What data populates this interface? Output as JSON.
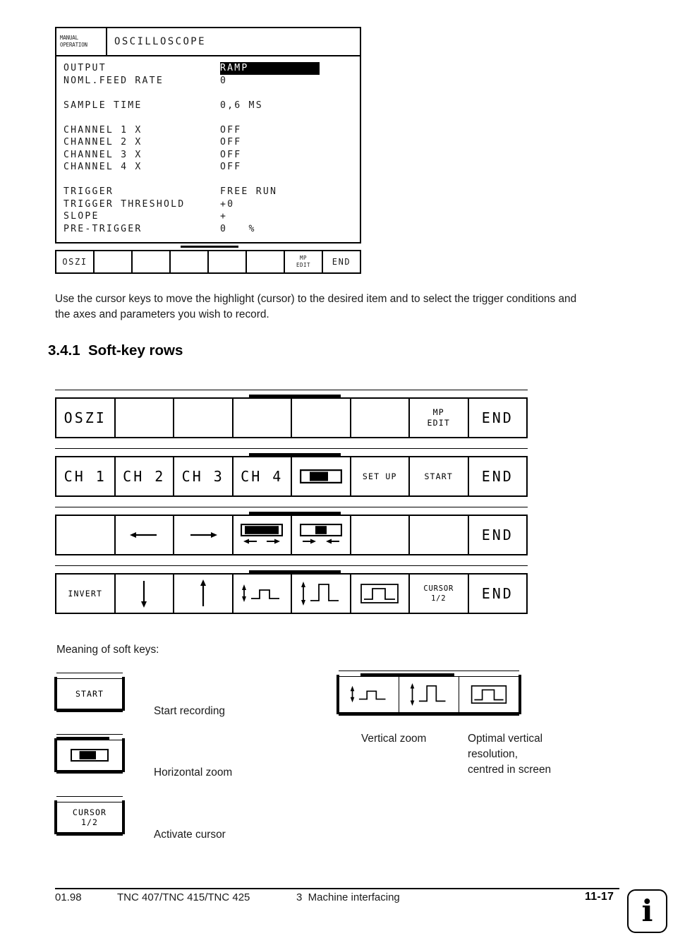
{
  "screen": {
    "mode_line1": "MANUAL",
    "mode_line2": "OPERATION",
    "title": "OSCILLOSCOPE",
    "rows": [
      {
        "label": "OUTPUT",
        "value": "RAMP",
        "highlight": true
      },
      {
        "label": "NOML.FEED RATE",
        "value": "0",
        "highlight": false
      },
      {
        "label": "",
        "value": "",
        "spacer": true
      },
      {
        "label": "SAMPLE TIME",
        "value": "0,6 MS",
        "highlight": false
      },
      {
        "label": "",
        "value": "",
        "spacer": true
      },
      {
        "label": "CHANNEL 1 X",
        "value": "OFF",
        "highlight": false
      },
      {
        "label": "CHANNEL 2 X",
        "value": "OFF",
        "highlight": false
      },
      {
        "label": "CHANNEL 3 X",
        "value": "OFF",
        "highlight": false
      },
      {
        "label": "CHANNEL 4 X",
        "value": "OFF",
        "highlight": false
      },
      {
        "label": "",
        "value": "",
        "spacer": true
      },
      {
        "label": "TRIGGER",
        "value": "FREE RUN",
        "highlight": false
      },
      {
        "label": "TRIGGER THRESHOLD",
        "value": "+0",
        "highlight": false
      },
      {
        "label": "SLOPE",
        "value": "+",
        "highlight": false
      },
      {
        "label": "PRE-TRIGGER",
        "value": "0   %",
        "highlight": false
      }
    ],
    "softkeys": [
      {
        "label": "OSZI",
        "icon": null
      },
      {
        "label": "",
        "icon": null
      },
      {
        "label": "",
        "icon": null
      },
      {
        "label": "",
        "icon": null
      },
      {
        "label": "",
        "icon": null
      },
      {
        "label": "",
        "icon": null
      },
      {
        "label": "MP\nEDIT",
        "icon": null
      },
      {
        "label": "END",
        "icon": null
      }
    ]
  },
  "body_text": "Use the cursor keys to move the highlight (cursor) to the desired item and to select the trigger conditions and the axes and parameters you wish to record.",
  "heading": "3.4.1  Soft-key rows",
  "softkey_rows": [
    {
      "name": "row-1",
      "keys": [
        {
          "label": "OSZI",
          "icon": null,
          "size": "lg"
        },
        {
          "label": "",
          "icon": null,
          "size": "lg"
        },
        {
          "label": "",
          "icon": null,
          "size": "lg"
        },
        {
          "label": "",
          "icon": null,
          "size": "lg"
        },
        {
          "label": "",
          "icon": null,
          "size": "lg"
        },
        {
          "label": "",
          "icon": null,
          "size": "lg"
        },
        {
          "label": "MP EDIT",
          "icon": null,
          "size": "sm",
          "line1": "MP",
          "line2": "EDIT"
        },
        {
          "label": "END",
          "icon": null,
          "size": "lg"
        }
      ]
    },
    {
      "name": "row-2",
      "keys": [
        {
          "label": "CH 1",
          "icon": null,
          "size": "lg"
        },
        {
          "label": "CH 2",
          "icon": null,
          "size": "lg"
        },
        {
          "label": "CH 3",
          "icon": null,
          "size": "lg"
        },
        {
          "label": "CH 4",
          "icon": null,
          "size": "lg"
        },
        {
          "label": "",
          "icon": "horizontal-zoom-icon",
          "size": "lg"
        },
        {
          "label": "SET UP",
          "icon": null,
          "size": "sm"
        },
        {
          "label": "START",
          "icon": null,
          "size": "sm"
        },
        {
          "label": "END",
          "icon": null,
          "size": "lg"
        }
      ]
    },
    {
      "name": "row-3",
      "keys": [
        {
          "label": "",
          "icon": null,
          "size": "lg"
        },
        {
          "label": "",
          "icon": "arrow-left-icon",
          "size": "lg"
        },
        {
          "label": "",
          "icon": "arrow-right-icon",
          "size": "lg"
        },
        {
          "label": "",
          "icon": "zoom-expand-horizontal-icon",
          "size": "lg"
        },
        {
          "label": "",
          "icon": "zoom-contract-horizontal-icon",
          "size": "lg"
        },
        {
          "label": "",
          "icon": null,
          "size": "lg"
        },
        {
          "label": "",
          "icon": null,
          "size": "lg"
        },
        {
          "label": "END",
          "icon": null,
          "size": "lg"
        }
      ]
    },
    {
      "name": "row-4",
      "keys": [
        {
          "label": "INVERT",
          "icon": null,
          "size": "sm"
        },
        {
          "label": "",
          "icon": "arrow-down-icon",
          "size": "lg"
        },
        {
          "label": "",
          "icon": "arrow-up-icon",
          "size": "lg"
        },
        {
          "label": "",
          "icon": "pulse-shrink-icon",
          "size": "lg"
        },
        {
          "label": "",
          "icon": "pulse-grow-icon",
          "size": "lg"
        },
        {
          "label": "",
          "icon": "pulse-fit-icon",
          "size": "lg"
        },
        {
          "label": "CURSOR 1/2",
          "icon": null,
          "size": "xs",
          "line1": "CURSOR",
          "line2": "1/2"
        },
        {
          "label": "END",
          "icon": null,
          "size": "lg"
        }
      ]
    }
  ],
  "legend": {
    "title": "Meaning of soft keys:",
    "items": [
      {
        "key_label": "START",
        "icon": null,
        "caption": "Start recording",
        "rail_fill": 0
      },
      {
        "key_label": "",
        "icon": "horizontal-zoom-icon",
        "caption": "Horizontal zoom",
        "rail_fill": 80
      },
      {
        "key_label": "CURSOR 1/2",
        "line1": "CURSOR",
        "line2": "1/2",
        "icon": null,
        "caption": "Activate cursor",
        "rail_fill": 0
      }
    ],
    "group": {
      "rail_fill_start": 12,
      "rail_fill_width": 52,
      "keys": [
        {
          "icon": "pulse-shrink-icon"
        },
        {
          "icon": "pulse-grow-icon"
        },
        {
          "icon": "pulse-fit-icon"
        }
      ],
      "captions": [
        "Vertical zoom",
        "Optimal vertical\nresolution,\ncentred in screen"
      ],
      "caption_vertical_zoom": "Vertical zoom",
      "caption_optimal_l1": "Optimal vertical",
      "caption_optimal_l2": "resolution,",
      "caption_optimal_l3": "centred in screen"
    }
  },
  "footer": {
    "date": "01.98",
    "product": "TNC 407/TNC 415/TNC 425",
    "chapter": "3  Machine interfacing",
    "page": "11-17",
    "info_glyph": "i"
  },
  "colors": {
    "ink": "#000000",
    "text": "#1a1a1a",
    "paper": "#ffffff"
  }
}
